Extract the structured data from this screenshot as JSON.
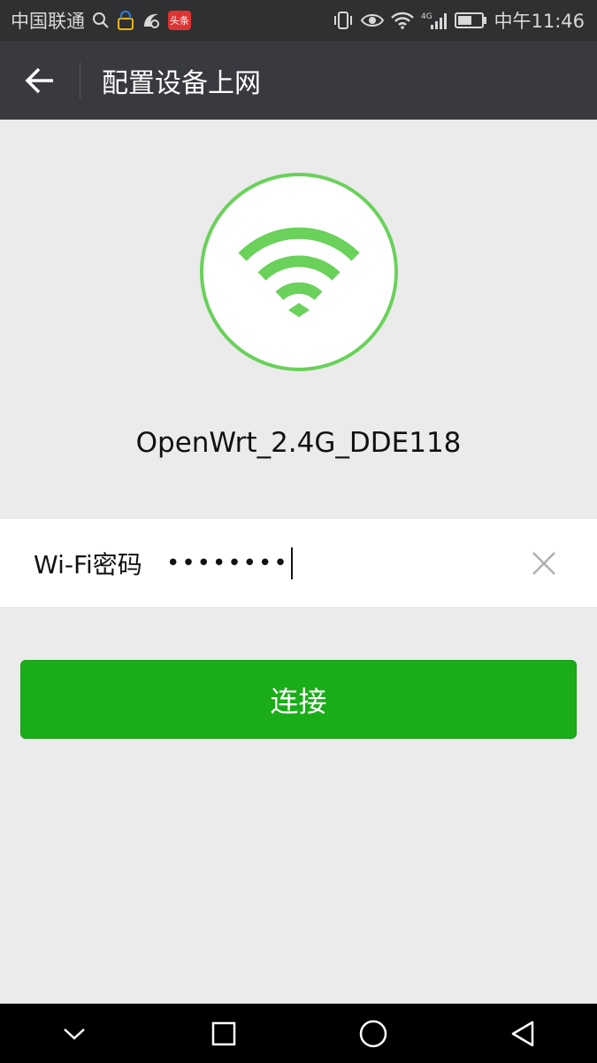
{
  "status_bar": {
    "carrier": "中国联通",
    "time": "中午11:46",
    "notification_badge": "头条",
    "network_type": "4G",
    "icons_left": [
      "search-icon",
      "lock-icon",
      "uc-browser-icon",
      "toutiao-icon"
    ],
    "icons_right": [
      "vibrate-icon",
      "eye-icon",
      "wifi-icon",
      "signal-icon",
      "battery-icon"
    ]
  },
  "header": {
    "title": "配置设备上网",
    "back_icon": "arrow-left-icon"
  },
  "network": {
    "ssid": "OpenWrt_2.4G_DDE118",
    "icon": "wifi-icon",
    "accent_color": "#6ad15b"
  },
  "password_field": {
    "label": "Wi-Fi密码",
    "masked_value": "••••••••",
    "clear_icon": "close-icon"
  },
  "connect_button": {
    "label": "连接",
    "color": "#1aad19"
  },
  "nav_bar": {
    "icons": [
      "chevron-down-icon",
      "square-icon",
      "circle-icon",
      "triangle-back-icon"
    ]
  }
}
